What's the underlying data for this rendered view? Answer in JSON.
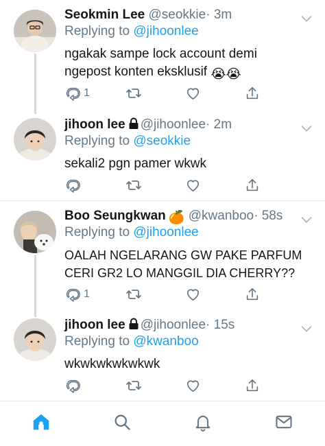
{
  "tweets": [
    {
      "name": "Seokmin Lee",
      "handle": "@seokkie",
      "time": "· 3m",
      "replying_prefix": "Replying to",
      "replying_to": "@jihoonlee",
      "text_line1": "ngakak sampe lock account demi",
      "text_line2": "ngepost konten eksklusif",
      "text_emoji": "😭😭",
      "reply_count": "1"
    },
    {
      "name": "jihoon lee",
      "handle": "@jihoonlee",
      "time": "· 2m",
      "replying_prefix": "Replying to",
      "replying_to": "@seokkie",
      "text": "sekali2 pgn pamer wkwk",
      "reply_count": ""
    },
    {
      "name": "Boo Seungkwan",
      "name_emoji": "🍊",
      "handle": "@kwanboo",
      "time": "· 58s",
      "replying_prefix": "Replying to",
      "replying_to": "@jihoonlee",
      "text_line1": "OALAH NGELARANG GW PAKE PARFUM",
      "text_line2": "CERI GR2 LO MANGGIL DIA CHERRY??",
      "reply_count": "1"
    },
    {
      "name": "jihoon lee",
      "handle": "@jihoonlee",
      "time": "· 15s",
      "replying_prefix": "Replying to",
      "replying_to": "@kwanboo",
      "text": "wkwkwkwkwkwk",
      "reply_count": ""
    }
  ],
  "icons": {
    "reply": "reply-icon",
    "retweet": "retweet-icon",
    "like": "heart-icon",
    "share": "share-icon",
    "caret": "chevron-down-icon",
    "lock": "lock-icon"
  },
  "tabbar": [
    "home-icon",
    "search-icon",
    "notifications-icon",
    "messages-icon"
  ],
  "colors": {
    "accent": "#1da1f2",
    "secondary_text": "#657786",
    "thread_line": "#cfd9de",
    "separator": "#e1e8ed"
  }
}
